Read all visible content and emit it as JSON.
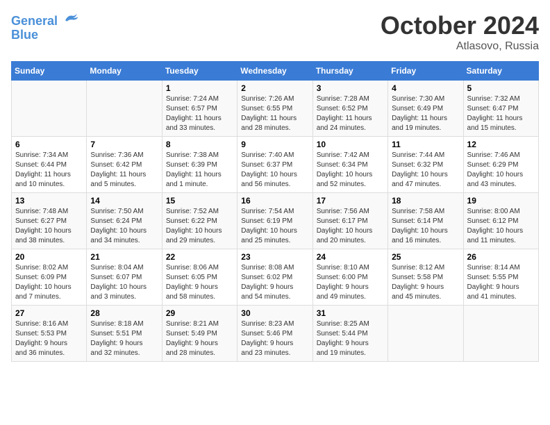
{
  "logo": {
    "line1": "General",
    "line2": "Blue"
  },
  "title": "October 2024",
  "location": "Atlasovo, Russia",
  "days_header": [
    "Sunday",
    "Monday",
    "Tuesday",
    "Wednesday",
    "Thursday",
    "Friday",
    "Saturday"
  ],
  "weeks": [
    [
      {
        "day": "",
        "info": ""
      },
      {
        "day": "",
        "info": ""
      },
      {
        "day": "1",
        "info": "Sunrise: 7:24 AM\nSunset: 6:57 PM\nDaylight: 11 hours\nand 33 minutes."
      },
      {
        "day": "2",
        "info": "Sunrise: 7:26 AM\nSunset: 6:55 PM\nDaylight: 11 hours\nand 28 minutes."
      },
      {
        "day": "3",
        "info": "Sunrise: 7:28 AM\nSunset: 6:52 PM\nDaylight: 11 hours\nand 24 minutes."
      },
      {
        "day": "4",
        "info": "Sunrise: 7:30 AM\nSunset: 6:49 PM\nDaylight: 11 hours\nand 19 minutes."
      },
      {
        "day": "5",
        "info": "Sunrise: 7:32 AM\nSunset: 6:47 PM\nDaylight: 11 hours\nand 15 minutes."
      }
    ],
    [
      {
        "day": "6",
        "info": "Sunrise: 7:34 AM\nSunset: 6:44 PM\nDaylight: 11 hours\nand 10 minutes."
      },
      {
        "day": "7",
        "info": "Sunrise: 7:36 AM\nSunset: 6:42 PM\nDaylight: 11 hours\nand 5 minutes."
      },
      {
        "day": "8",
        "info": "Sunrise: 7:38 AM\nSunset: 6:39 PM\nDaylight: 11 hours\nand 1 minute."
      },
      {
        "day": "9",
        "info": "Sunrise: 7:40 AM\nSunset: 6:37 PM\nDaylight: 10 hours\nand 56 minutes."
      },
      {
        "day": "10",
        "info": "Sunrise: 7:42 AM\nSunset: 6:34 PM\nDaylight: 10 hours\nand 52 minutes."
      },
      {
        "day": "11",
        "info": "Sunrise: 7:44 AM\nSunset: 6:32 PM\nDaylight: 10 hours\nand 47 minutes."
      },
      {
        "day": "12",
        "info": "Sunrise: 7:46 AM\nSunset: 6:29 PM\nDaylight: 10 hours\nand 43 minutes."
      }
    ],
    [
      {
        "day": "13",
        "info": "Sunrise: 7:48 AM\nSunset: 6:27 PM\nDaylight: 10 hours\nand 38 minutes."
      },
      {
        "day": "14",
        "info": "Sunrise: 7:50 AM\nSunset: 6:24 PM\nDaylight: 10 hours\nand 34 minutes."
      },
      {
        "day": "15",
        "info": "Sunrise: 7:52 AM\nSunset: 6:22 PM\nDaylight: 10 hours\nand 29 minutes."
      },
      {
        "day": "16",
        "info": "Sunrise: 7:54 AM\nSunset: 6:19 PM\nDaylight: 10 hours\nand 25 minutes."
      },
      {
        "day": "17",
        "info": "Sunrise: 7:56 AM\nSunset: 6:17 PM\nDaylight: 10 hours\nand 20 minutes."
      },
      {
        "day": "18",
        "info": "Sunrise: 7:58 AM\nSunset: 6:14 PM\nDaylight: 10 hours\nand 16 minutes."
      },
      {
        "day": "19",
        "info": "Sunrise: 8:00 AM\nSunset: 6:12 PM\nDaylight: 10 hours\nand 11 minutes."
      }
    ],
    [
      {
        "day": "20",
        "info": "Sunrise: 8:02 AM\nSunset: 6:09 PM\nDaylight: 10 hours\nand 7 minutes."
      },
      {
        "day": "21",
        "info": "Sunrise: 8:04 AM\nSunset: 6:07 PM\nDaylight: 10 hours\nand 3 minutes."
      },
      {
        "day": "22",
        "info": "Sunrise: 8:06 AM\nSunset: 6:05 PM\nDaylight: 9 hours\nand 58 minutes."
      },
      {
        "day": "23",
        "info": "Sunrise: 8:08 AM\nSunset: 6:02 PM\nDaylight: 9 hours\nand 54 minutes."
      },
      {
        "day": "24",
        "info": "Sunrise: 8:10 AM\nSunset: 6:00 PM\nDaylight: 9 hours\nand 49 minutes."
      },
      {
        "day": "25",
        "info": "Sunrise: 8:12 AM\nSunset: 5:58 PM\nDaylight: 9 hours\nand 45 minutes."
      },
      {
        "day": "26",
        "info": "Sunrise: 8:14 AM\nSunset: 5:55 PM\nDaylight: 9 hours\nand 41 minutes."
      }
    ],
    [
      {
        "day": "27",
        "info": "Sunrise: 8:16 AM\nSunset: 5:53 PM\nDaylight: 9 hours\nand 36 minutes."
      },
      {
        "day": "28",
        "info": "Sunrise: 8:18 AM\nSunset: 5:51 PM\nDaylight: 9 hours\nand 32 minutes."
      },
      {
        "day": "29",
        "info": "Sunrise: 8:21 AM\nSunset: 5:49 PM\nDaylight: 9 hours\nand 28 minutes."
      },
      {
        "day": "30",
        "info": "Sunrise: 8:23 AM\nSunset: 5:46 PM\nDaylight: 9 hours\nand 23 minutes."
      },
      {
        "day": "31",
        "info": "Sunrise: 8:25 AM\nSunset: 5:44 PM\nDaylight: 9 hours\nand 19 minutes."
      },
      {
        "day": "",
        "info": ""
      },
      {
        "day": "",
        "info": ""
      }
    ]
  ]
}
